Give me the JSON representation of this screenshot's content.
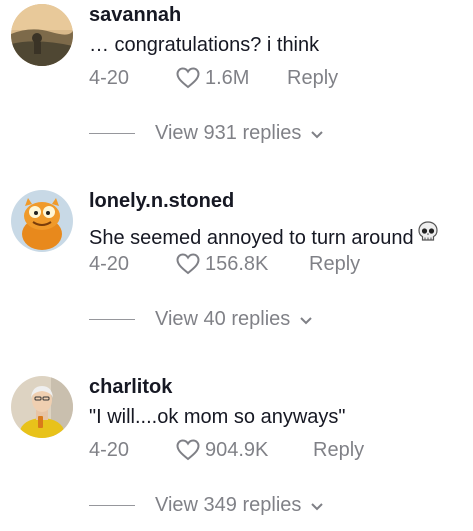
{
  "comments": [
    {
      "username": "savannah",
      "text": "… congratulations? i think",
      "date": "4-20",
      "likes": "1.6M",
      "reply_label": "Reply",
      "view_replies": "View 931 replies",
      "avatar": "landscape-avatar"
    },
    {
      "username": "lonely.n.stoned",
      "text": "She seemed annoyed to turn around",
      "emoji": "skull-emoji",
      "date": "4-20",
      "likes": "156.8K",
      "reply_label": "Reply",
      "view_replies": "View 40 replies",
      "avatar": "cartoon-cat-avatar"
    },
    {
      "username": "charlitok",
      "text": "\"I will....ok mom so anyways\"",
      "date": "4-20",
      "likes": "904.9K",
      "reply_label": "Reply",
      "view_replies": "View 349 replies",
      "avatar": "person-avatar"
    }
  ],
  "colors": {
    "primary_text": "#161823",
    "secondary_text": "rgba(22,24,35,0.55)"
  }
}
